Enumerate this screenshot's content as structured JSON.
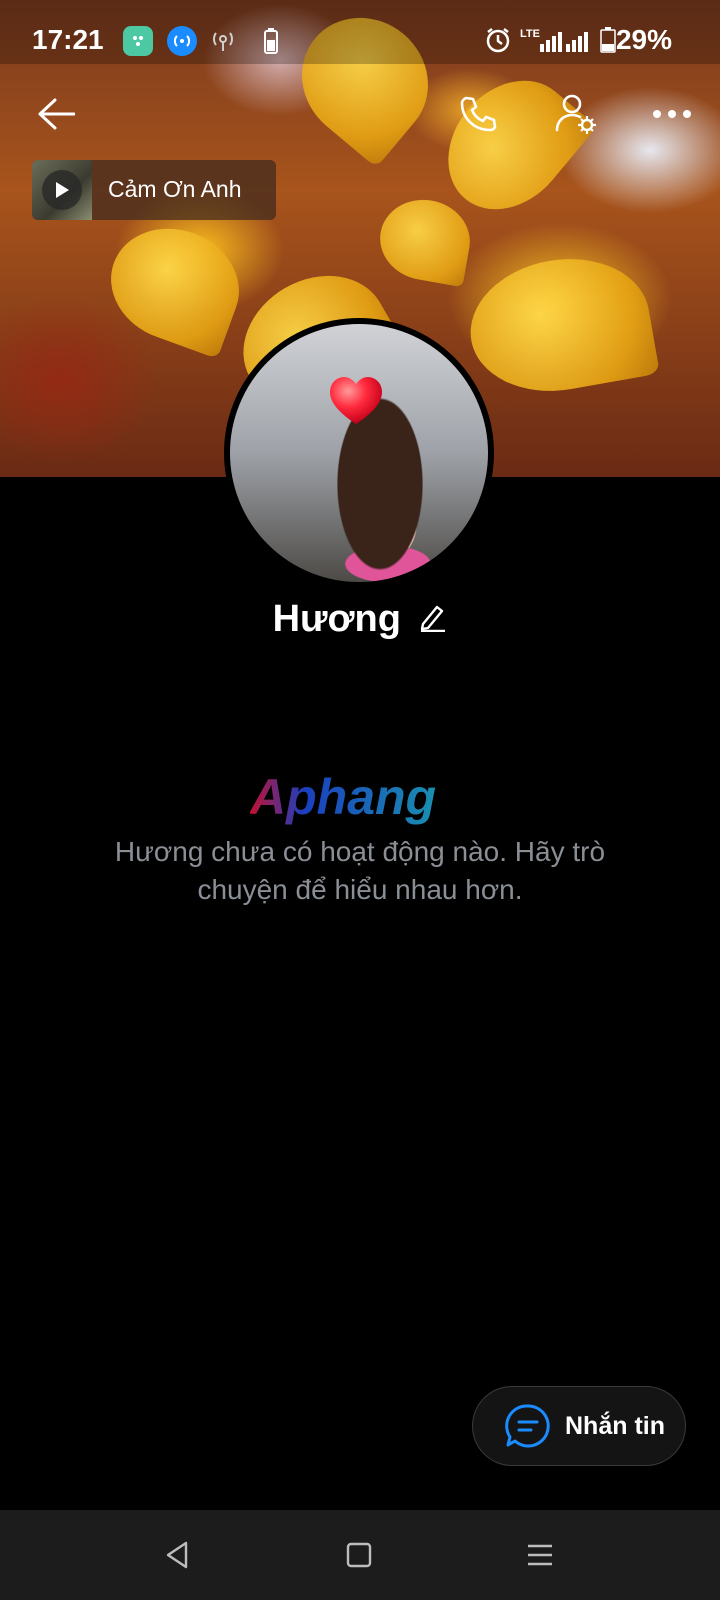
{
  "status_bar": {
    "time": "17:21",
    "network": "LTE",
    "battery": "29%",
    "icons": [
      "notification-app-icon",
      "wifi-hotspot-icon",
      "broadcast-icon",
      "battery-small-icon",
      "alarm-icon",
      "signal-icon",
      "battery-icon"
    ]
  },
  "header": {
    "back_icon": "arrow-left-icon",
    "call_icon": "phone-icon",
    "settings_icon": "user-settings-icon",
    "more_icon": "more-dots-icon"
  },
  "music": {
    "title": "Cảm Ơn Anh"
  },
  "profile": {
    "name": "Hương"
  },
  "watermark": {
    "text": "Aphang"
  },
  "empty_state": {
    "message": "Hương chưa có hoạt động nào. Hãy trò chuyện để hiểu nhau hơn."
  },
  "fab": {
    "label": "Nhắn tin"
  },
  "colors": {
    "background": "#000000",
    "accent_blue": "#1a8cff",
    "muted_text": "#8a8f96"
  }
}
